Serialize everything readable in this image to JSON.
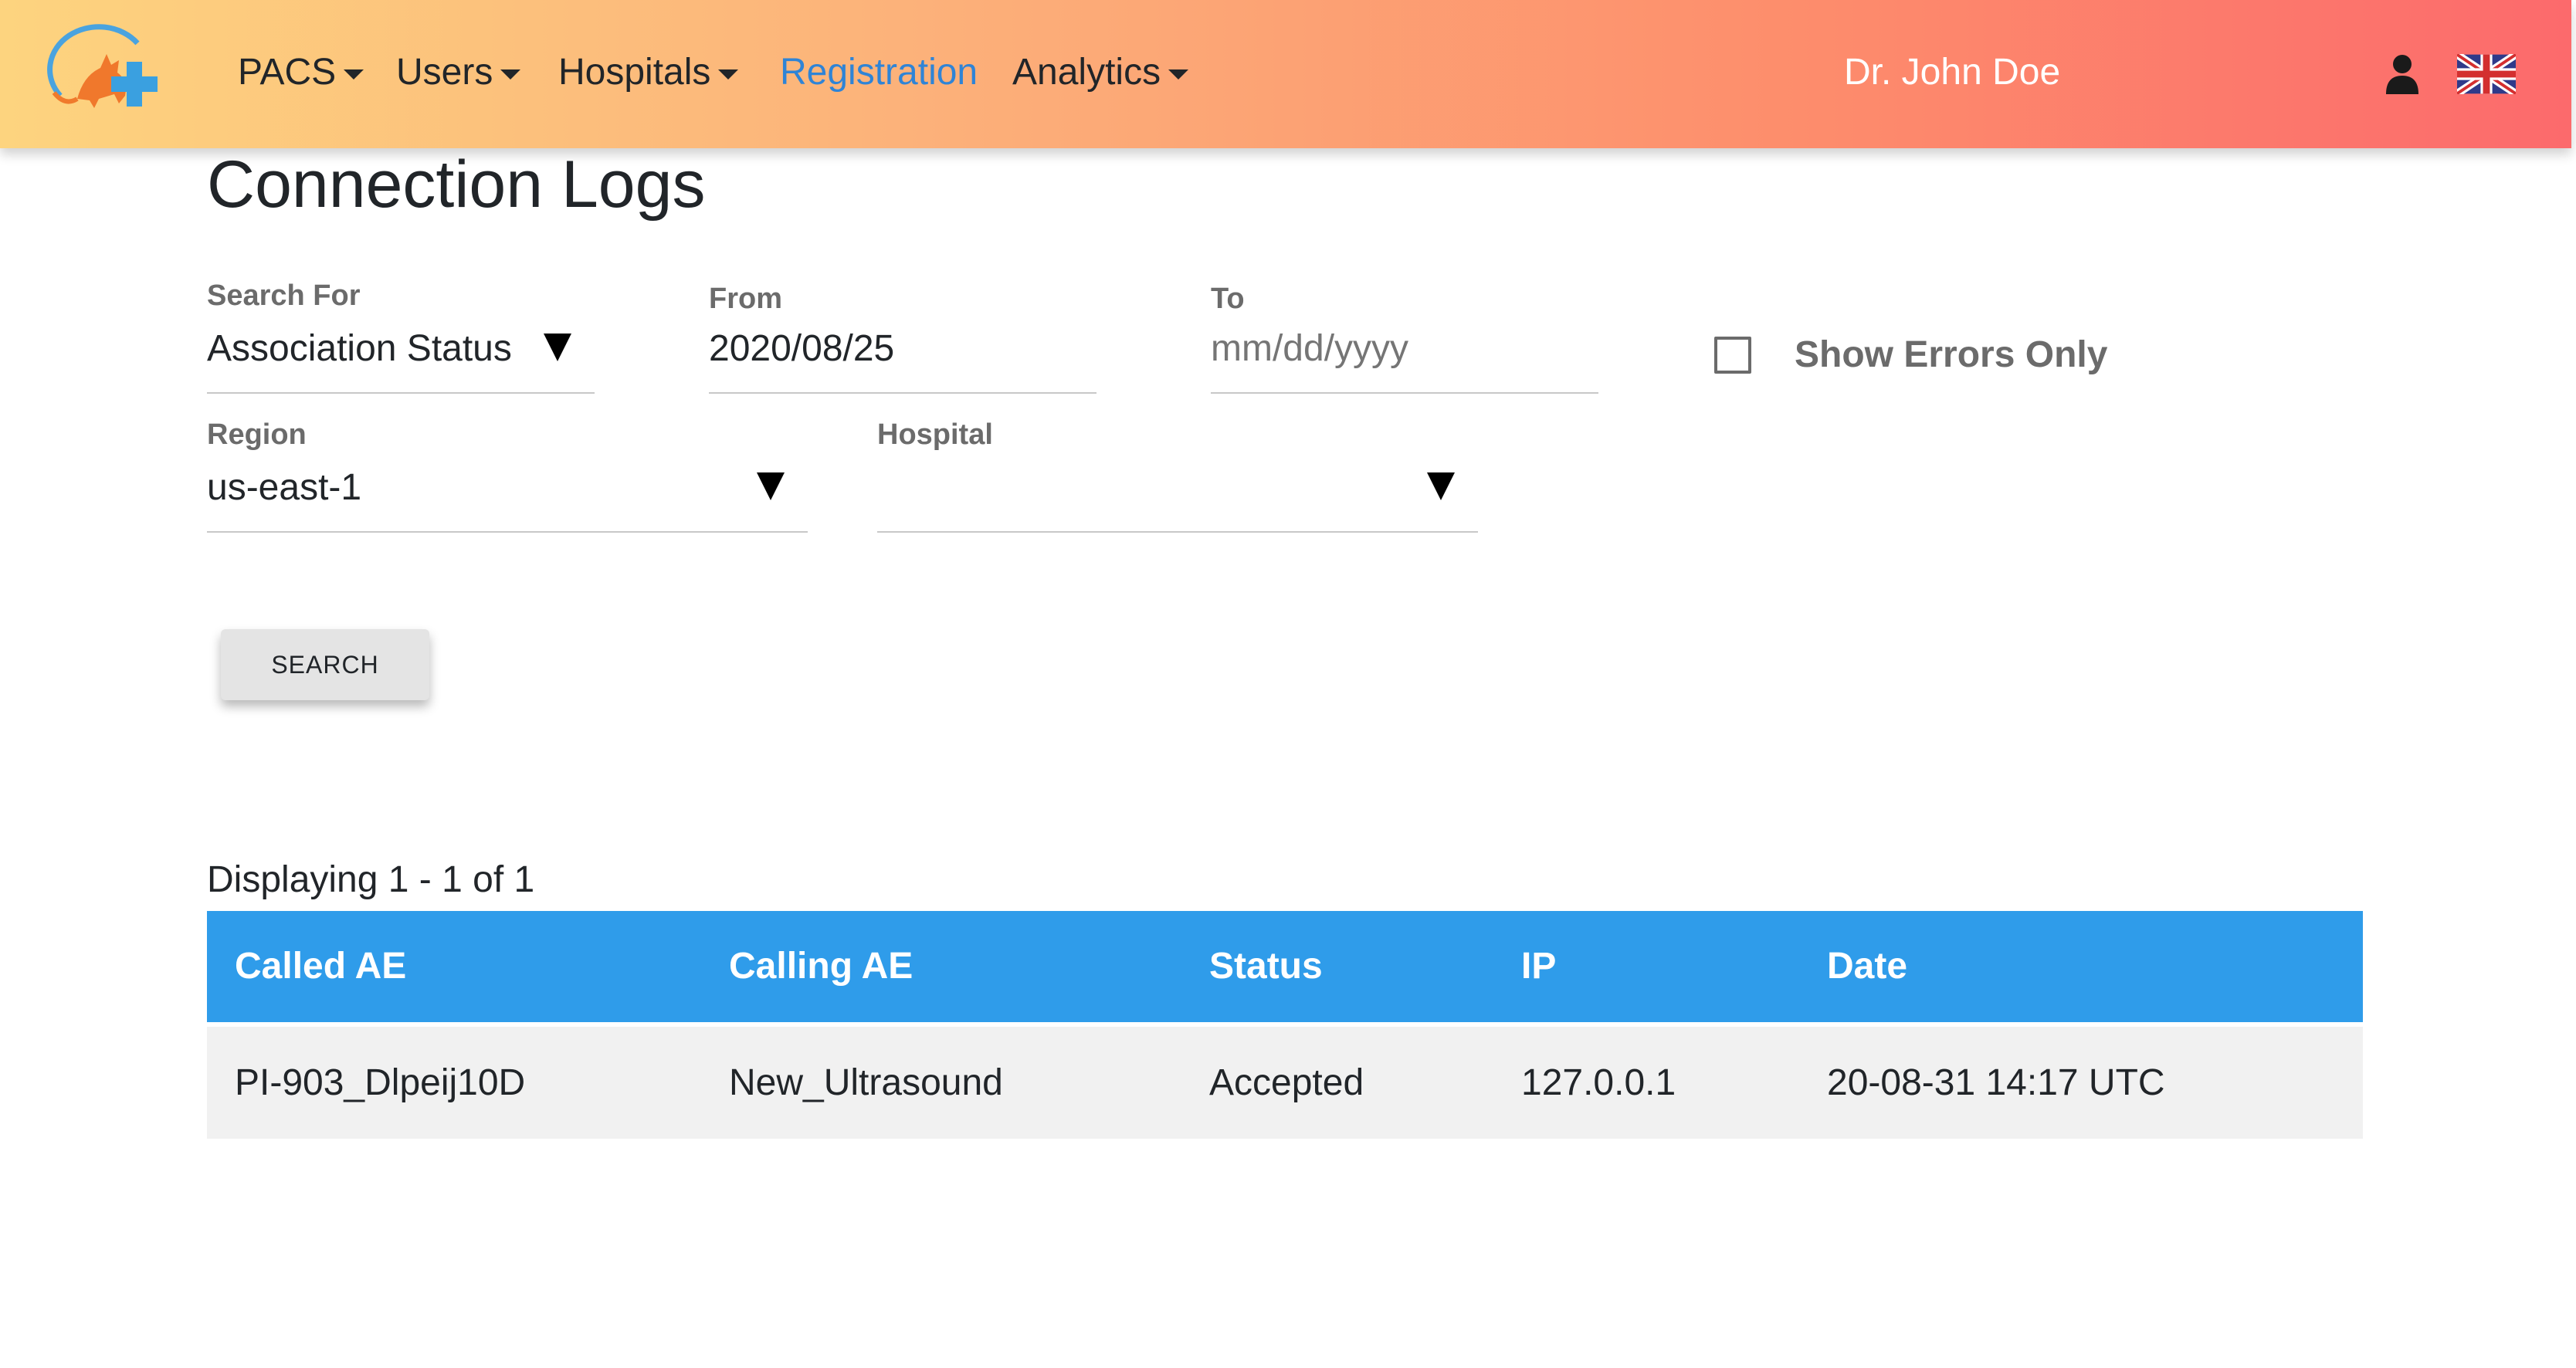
{
  "nav": {
    "items": [
      {
        "label": "PACS",
        "dropdown": true
      },
      {
        "label": "Users",
        "dropdown": true
      },
      {
        "label": "Hospitals",
        "dropdown": true
      },
      {
        "label": "Registration",
        "dropdown": false,
        "active": true
      },
      {
        "label": "Analytics",
        "dropdown": true
      }
    ],
    "user_name": "Dr. John Doe",
    "icons": [
      "logo-icon",
      "user-icon",
      "uk-flag-icon"
    ],
    "colors": {
      "gradient_start": "#fdd47f",
      "gradient_end": "#fc6a6c",
      "active_link": "#2f84d6"
    }
  },
  "page": {
    "title": "Connection Logs"
  },
  "filters": {
    "search_for": {
      "label": "Search For",
      "value": "Association Status"
    },
    "from": {
      "label": "From",
      "value": "2020/08/25"
    },
    "to": {
      "label": "To",
      "placeholder": "mm/dd/yyyy"
    },
    "errors_only": {
      "label": "Show Errors Only",
      "checked": false
    },
    "region": {
      "label": "Region",
      "value": "us-east-1"
    },
    "hospital": {
      "label": "Hospital",
      "value": ""
    }
  },
  "search_button": "SEARCH",
  "results": {
    "count_text": "Displaying 1 - 1 of 1",
    "columns": [
      "Called AE",
      "Calling AE",
      "Status",
      "IP",
      "Date"
    ],
    "rows": [
      [
        "PI-903_Dlpeij10D",
        "New_Ultrasound",
        "Accepted",
        "127.0.0.1",
        "20-08-31 14:17 UTC"
      ]
    ],
    "header_color": "#2f9cea"
  }
}
